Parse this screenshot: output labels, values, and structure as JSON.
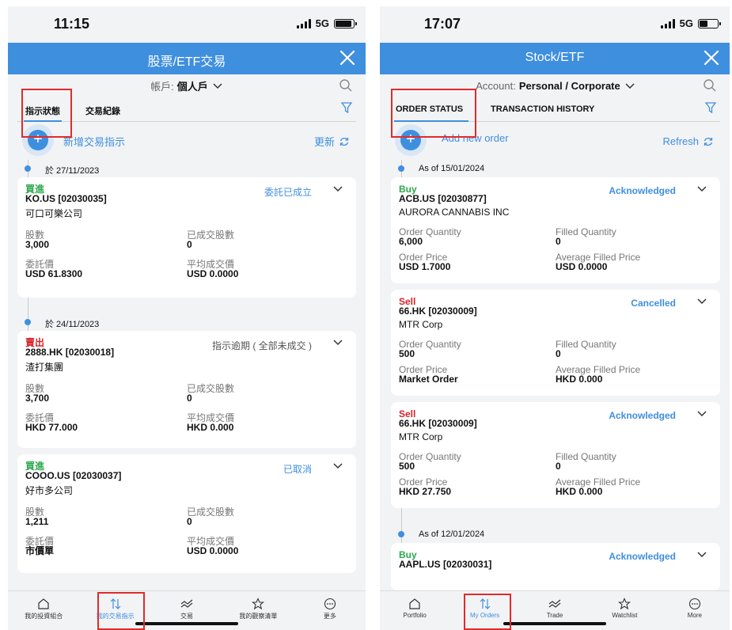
{
  "left": {
    "time": "11:15",
    "network": "5G",
    "header_title": "股票/ETF交易",
    "account_label": "帳戶:",
    "account_value": "個人戶",
    "tabs": [
      "指示狀態",
      "交易紀錄"
    ],
    "add_label": "新增交易指示",
    "refresh_label": "更新",
    "groups": [
      {
        "date": "於 27/11/2023"
      },
      {
        "date": "於 24/11/2023"
      }
    ],
    "orders": [
      {
        "side": "買進",
        "code": "KO.US [02030035]",
        "name": "可口可樂公司",
        "status": "委託已成立",
        "f1l": "股數",
        "f1v": "3,000",
        "f2l": "已成交股數",
        "f2v": "0",
        "f3l": "委託價",
        "f3v": "USD 61.8300",
        "f4l": "平均成交價",
        "f4v": "USD 0.0000"
      },
      {
        "side": "賣出",
        "code": "2888.HK [02030018]",
        "name": "渣打集團",
        "status": "指示逾期 ( 全部未成交 )",
        "f1l": "股數",
        "f1v": "3,700",
        "f2l": "已成交股數",
        "f2v": "0",
        "f3l": "委託價",
        "f3v": "HKD 77.000",
        "f4l": "平均成交價",
        "f4v": "HKD 0.000"
      },
      {
        "side": "買進",
        "code": "COOO.US [02030037]",
        "name": "好市多公司",
        "status": "已取消",
        "f1l": "股數",
        "f1v": "1,211",
        "f2l": "已成交股數",
        "f2v": "0",
        "f3l": "委託價",
        "f3v": "市價單",
        "f4l": "平均成交價",
        "f4v": "USD 0.0000"
      }
    ],
    "nav": [
      "我的投資組合",
      "我的交易指示",
      "交易",
      "我的觀察清單",
      "更多"
    ]
  },
  "right": {
    "time": "17:07",
    "network": "5G",
    "header_title": "Stock/ETF",
    "account_label": "Account:",
    "account_value": "Personal / Corporate",
    "tabs": [
      "ORDER STATUS",
      "TRANSACTION HISTORY"
    ],
    "add_label": "Add new order",
    "refresh_label": "Refresh",
    "groups": [
      {
        "date": "As of 15/01/2024"
      },
      {
        "date": "As of 12/01/2024"
      }
    ],
    "orders": [
      {
        "side": "Buy",
        "code": "ACB.US [02030877]",
        "name": "AURORA CANNABIS INC",
        "status": "Acknowledged",
        "f1l": "Order Quantity",
        "f1v": "6,000",
        "f2l": "Filled Quantity",
        "f2v": "0",
        "f3l": "Order Price",
        "f3v": "USD 1.7000",
        "f4l": "Average Filled Price",
        "f4v": "USD 0.0000"
      },
      {
        "side": "Sell",
        "code": "66.HK [02030009]",
        "name": "MTR Corp",
        "status": "Cancelled",
        "f1l": "Order Quantity",
        "f1v": "500",
        "f2l": "Filled Quantity",
        "f2v": "0",
        "f3l": "Order Price",
        "f3v": "Market Order",
        "f4l": "Average Filled Price",
        "f4v": "HKD 0.000"
      },
      {
        "side": "Sell",
        "code": "66.HK [02030009]",
        "name": "MTR Corp",
        "status": "Acknowledged",
        "f1l": "Order Quantity",
        "f1v": "500",
        "f2l": "Filled Quantity",
        "f2v": "0",
        "f3l": "Order Price",
        "f3v": "HKD 27.750",
        "f4l": "Average Filled Price",
        "f4v": "HKD 0.000"
      },
      {
        "side": "Buy",
        "code": "AAPL.US [02030031]",
        "status": "Acknowledged"
      }
    ],
    "nav": [
      "Portfolio",
      "My Orders",
      "Trade",
      "Watchlist",
      "More"
    ]
  },
  "colors": {
    "accent": "#3f8fdf",
    "buy": "#2aa84a",
    "sell": "#d8232a",
    "highlight": "#e02b2b"
  }
}
